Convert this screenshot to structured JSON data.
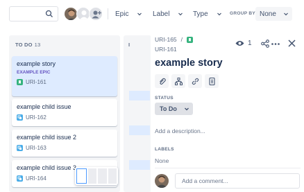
{
  "toolbar": {
    "search": {
      "placeholder": "",
      "icon": "search-icon"
    },
    "avatars": [
      {
        "name": "user-avatar",
        "kind": "photo"
      },
      {
        "name": "unassigned-avatar",
        "kind": "generic"
      },
      {
        "name": "add-people",
        "kind": "add-person"
      }
    ],
    "filters": [
      {
        "label": "Epic"
      },
      {
        "label": "Label"
      },
      {
        "label": "Type"
      }
    ],
    "group_by_label": "GROUP BY",
    "group_by_value": "None"
  },
  "board": {
    "columns": [
      {
        "title": "TO DO",
        "count": "13"
      },
      {
        "title": "I",
        "count": ""
      }
    ],
    "cards": [
      {
        "title": "example story",
        "epic": "EXAMPLE EPIC",
        "key": "URI-161",
        "type": "story",
        "selected": true
      },
      {
        "title": "example child issue",
        "epic": "",
        "key": "URI-162",
        "type": "subtask",
        "selected": false
      },
      {
        "title": "example child issue 2",
        "epic": "",
        "key": "URI-163",
        "type": "subtask",
        "selected": false
      },
      {
        "title": "example child issue 3",
        "epic": "",
        "key": "URI-164",
        "type": "subtask",
        "selected": false
      }
    ]
  },
  "detail": {
    "breadcrumb_parent": "URI-165",
    "breadcrumb_sep": "/",
    "breadcrumb_key": "URI-161",
    "watch_count": "1",
    "title": "example story",
    "status_label": "STATUS",
    "status_value": "To Do",
    "description_placeholder": "Add a description...",
    "labels_label": "LABELS",
    "labels_value": "None",
    "comment_placeholder": "Add a comment..."
  },
  "colors": {
    "story": "#36B37E",
    "subtask": "#4BADE8",
    "epic": "#6554C0",
    "selected_card": "#DEEBFF"
  }
}
